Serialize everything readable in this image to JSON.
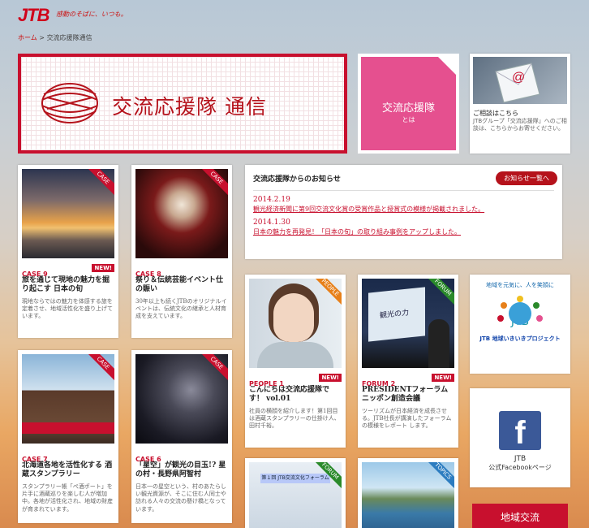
{
  "header": {
    "logo": "JTB",
    "tagline": "感動のそばに、いつも。"
  },
  "breadcrumb": {
    "home": "ホーム",
    "sep": " > ",
    "current": "交流応援隊通信"
  },
  "hero": {
    "title": "交流応援隊 通信"
  },
  "about": {
    "title": "交流応援隊",
    "sub": "とは"
  },
  "contact": {
    "heading": "ご相談はこちら",
    "body": "JTBグループ「交流応援隊」へのご相談は、こちらからお寄せください。",
    "icon": "@"
  },
  "news": {
    "heading": "交流応援隊からのお知らせ",
    "more": "お知らせ一覧へ",
    "items": [
      {
        "date": "2014.2.19",
        "text": "観光経済新聞に第9回交流文化賞の受賞作品と授賞式の模様が掲載されました。"
      },
      {
        "date": "2014.1.30",
        "text": "日本の魅力を再発見！「日本の旬」の取り組み事例をアップしました。"
      }
    ]
  },
  "cards": {
    "c9": {
      "ribbon": "CASE",
      "tag": "CASE 9",
      "new": "NEW!",
      "title": "旅を通じて現地の魅力を掘り起こす 日本の旬",
      "desc": "現地ならではの魅力を体感する旅を定着させ、地域活性化を盛り上げています。"
    },
    "c8": {
      "ribbon": "CASE",
      "tag": "CASE 8",
      "title": "祭り＆伝統芸能イベント仕の賑い",
      "desc": "30年以上も続くJTBのオリジナルイベントは、伝統文化の継承と人材育成を支えています。"
    },
    "people": {
      "ribbon": "PEOPLE",
      "tag": "PEOPLE 1",
      "new": "NEW!",
      "title": "こんにちは交流応援隊です！ vol.01",
      "desc": "社員の横顔を紹介します！第1回目は酒蔵スタンプラリーの仕掛け人、田村千裕。"
    },
    "forum": {
      "ribbon": "FORUM",
      "tag": "FORUM 2",
      "new": "NEW!",
      "title": "PRESIDENTフォーラム ニッポン創造会議",
      "desc": "ツーリズムが日本経済を成長させる。JTB社長が講演したフォーラムの模様をレポート します。",
      "slide": "観光の力"
    },
    "c7": {
      "ribbon": "CASE",
      "tag": "CASE 7",
      "title": "北海道各地を活性化する 酒蔵スタンプラリー",
      "desc": "スタンプラリー帳「ぺ酒ポート」を片手に酒蔵巡りを楽しむ人が増加中。各地が活性化され、地域の財産が育まれています。"
    },
    "c6": {
      "ribbon": "CASE",
      "tag": "CASE 6",
      "title": "「星空」が観光の目玉!? 星の村・長野県阿智村",
      "desc": "日本一の星空という、村のあたらしい観光資源が、そこに住む人同士や訪れる人々の交流の懸け橋となっています。"
    },
    "forum2": {
      "ribbon": "FORUM",
      "banner": "第１回 JTB交流文化フォーラム"
    },
    "topics": {
      "ribbon": "TOPICS"
    }
  },
  "jtbproj": {
    "top": "地域を元気に、人を笑顔に",
    "mid": "JTB",
    "bottom": "JTB 地球いきいきプロジェクト"
  },
  "facebook": {
    "icon": "f",
    "line1": "JTB",
    "line2": "公式Facebookページ"
  },
  "bottom_red": {
    "label": "地域交流"
  }
}
